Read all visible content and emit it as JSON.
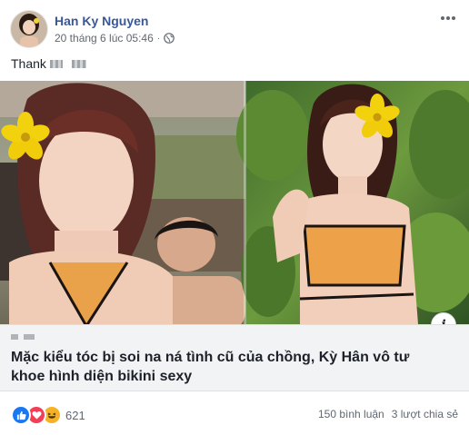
{
  "post": {
    "author": "Han Ky Nguyen",
    "timestamp": "20 tháng 6 lúc 05:46",
    "separator": "·",
    "audience_icon": "globe-icon",
    "caption": "Thank",
    "more_icon": "more-options-icon"
  },
  "link_preview": {
    "title": "Mặc kiểu tóc bị soi na ná tình cũ của chồng, Kỳ Hân vô tư khoe hình diện bikini sexy",
    "info_icon": "info-icon",
    "info_label": "i"
  },
  "engagement": {
    "reaction_icons": [
      "like-icon",
      "love-icon",
      "haha-icon"
    ],
    "reaction_count": "621",
    "comments": "150 bình luận",
    "shares": "3 lượt chia sẻ"
  },
  "colors": {
    "author_link": "#385898",
    "meta_text": "#616770",
    "like_blue": "#1877f2",
    "love_red": "#f33e58",
    "haha_yellow": "#f7b125",
    "link_box_bg": "#f2f3f5"
  }
}
